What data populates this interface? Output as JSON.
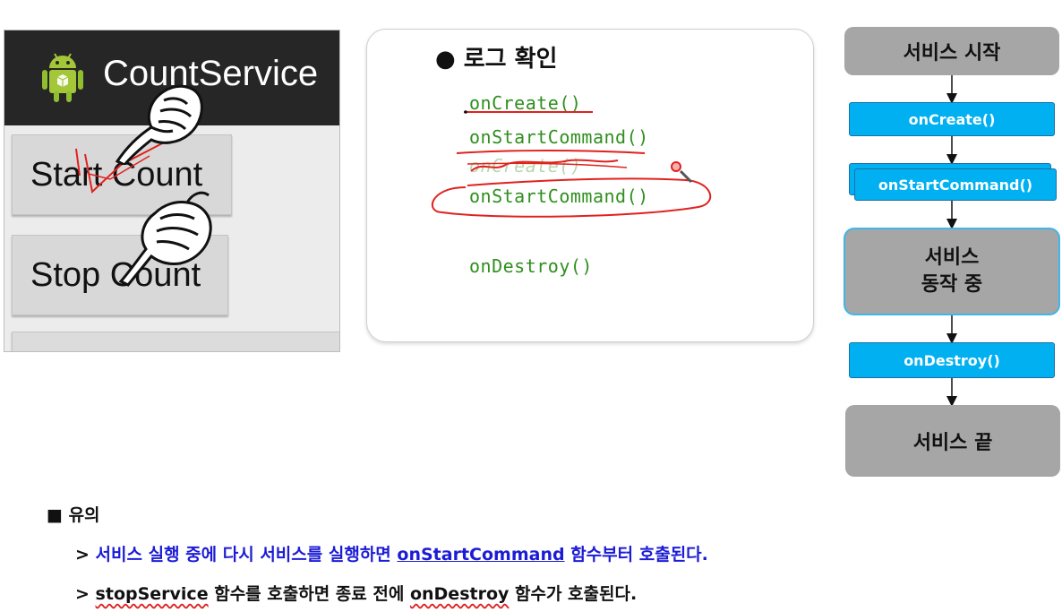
{
  "app": {
    "title": "CountService",
    "buttons": [
      {
        "label": "Start Count"
      },
      {
        "label": "Stop Count"
      }
    ],
    "icon": "android-icon",
    "pointer_icon": "pointing-hand-icon"
  },
  "log": {
    "bullet": "●",
    "title": "로그 확인",
    "lines": [
      "onCreate()",
      "onStartCommand()",
      "onCreate()",
      "onStartCommand()",
      "onDestroy()"
    ]
  },
  "flow": {
    "start": "서비스 시작",
    "on_create": "onCreate()",
    "on_start_command": "onStartCommand()",
    "running_line1": "서비스",
    "running_line2": "동작 중",
    "on_destroy": "onDestroy()",
    "end": "서비스 끝"
  },
  "notes": {
    "marker": "■",
    "heading": "유의",
    "note1": {
      "prefix": "> ",
      "part1": "서비스 실행 중에 다시 서비스를 실행하면 ",
      "keyword": "onStartCommand",
      "part2": " 함수부터 호출된다."
    },
    "note2": {
      "prefix": "> ",
      "keyword1": "stopService",
      "part1": " 함수를 호출하면 종료 전에 ",
      "keyword2": "onDestroy",
      "part2": " 함수가 호출된다."
    }
  },
  "colors": {
    "flow_blue": "#00b0f0",
    "flow_gray": "#a6a6a6",
    "log_green": "#2f8f1e",
    "annotation_red": "#e0221e",
    "note_blue": "#1c1cd6"
  }
}
